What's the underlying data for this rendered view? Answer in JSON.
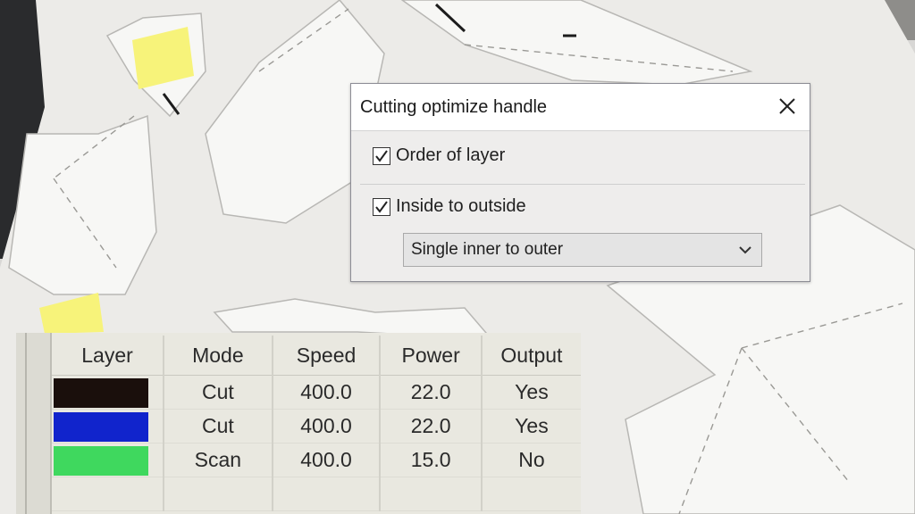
{
  "dialog": {
    "title": "Cutting optimize handle",
    "options": [
      {
        "label": "Order of layer",
        "checked": true
      },
      {
        "label": "Inside to outside",
        "checked": true
      }
    ],
    "inside_mode": "Single inner to outer"
  },
  "layer_table": {
    "headers": [
      "Layer",
      "Mode",
      "Speed",
      "Power",
      "Output"
    ],
    "rows": [
      {
        "color": "#1a0f0c",
        "mode": "Cut",
        "speed": "400.0",
        "power": "22.0",
        "output": "Yes"
      },
      {
        "color": "#1124cc",
        "mode": "Cut",
        "speed": "400.0",
        "power": "22.0",
        "output": "Yes"
      },
      {
        "color": "#3fd85e",
        "mode": "Scan",
        "speed": "400.0",
        "power": "15.0",
        "output": "No"
      }
    ]
  }
}
